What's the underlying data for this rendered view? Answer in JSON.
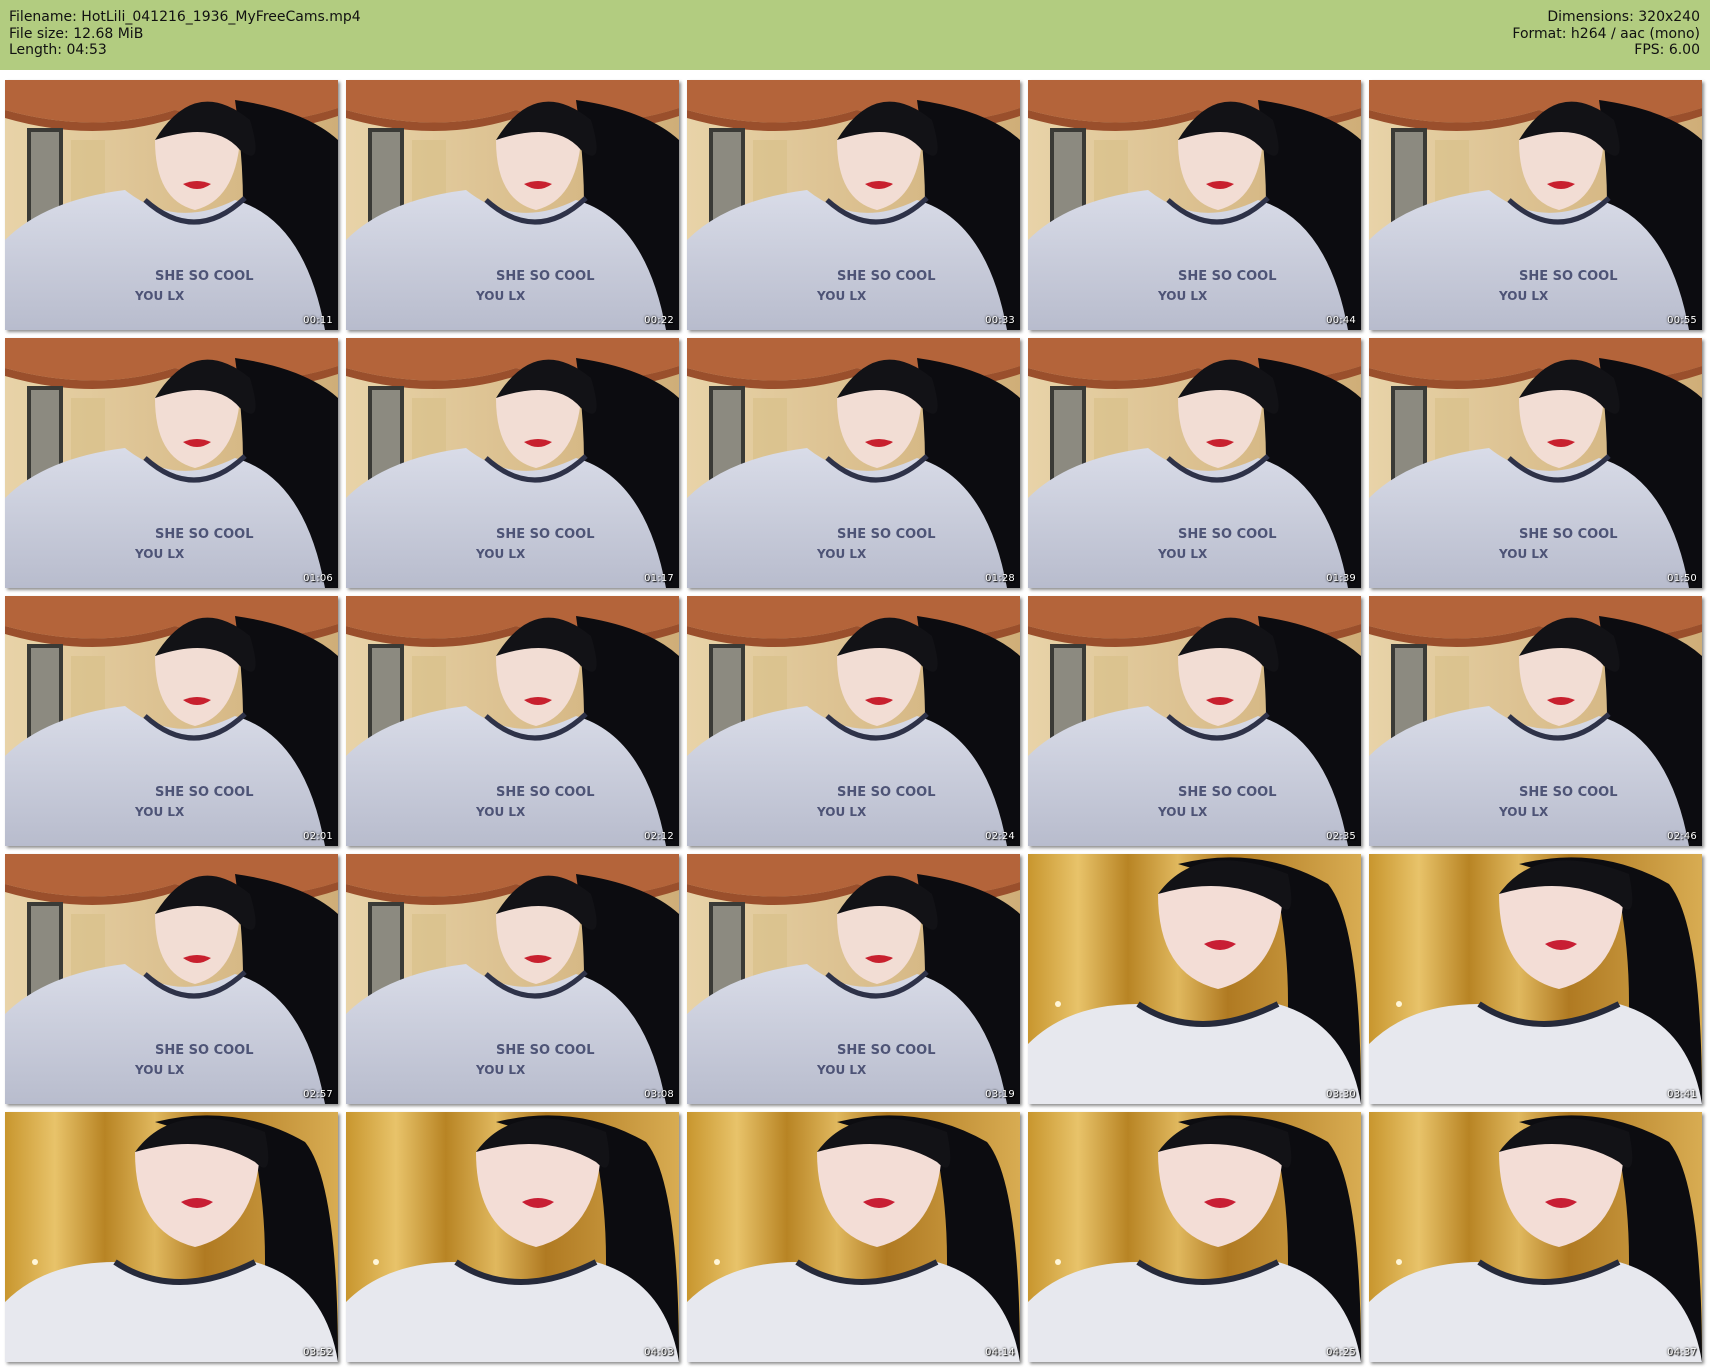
{
  "header": {
    "filename_line": "Filename: HotLili_041216_1936_MyFreeCams.mp4",
    "filesize_line": "File size: 12.68 MiB",
    "length_line": "Length: 04:53",
    "dimensions_line": "Dimensions: 320x240",
    "format_line": "Format: h264 / aac (mono)",
    "fps_line": "FPS: 6.00",
    "background_color": "#b2cc80"
  },
  "thumbnails": [
    {
      "timestamp": "00:11",
      "scene": "room"
    },
    {
      "timestamp": "00:22",
      "scene": "room"
    },
    {
      "timestamp": "00:33",
      "scene": "room"
    },
    {
      "timestamp": "00:44",
      "scene": "room"
    },
    {
      "timestamp": "00:55",
      "scene": "room"
    },
    {
      "timestamp": "01:06",
      "scene": "room"
    },
    {
      "timestamp": "01:17",
      "scene": "room"
    },
    {
      "timestamp": "01:28",
      "scene": "room"
    },
    {
      "timestamp": "01:39",
      "scene": "room"
    },
    {
      "timestamp": "01:50",
      "scene": "room"
    },
    {
      "timestamp": "02:01",
      "scene": "room"
    },
    {
      "timestamp": "02:12",
      "scene": "room"
    },
    {
      "timestamp": "02:24",
      "scene": "room"
    },
    {
      "timestamp": "02:35",
      "scene": "room"
    },
    {
      "timestamp": "02:46",
      "scene": "room"
    },
    {
      "timestamp": "02:57",
      "scene": "room"
    },
    {
      "timestamp": "03:08",
      "scene": "room"
    },
    {
      "timestamp": "03:19",
      "scene": "room"
    },
    {
      "timestamp": "03:30",
      "scene": "curtain"
    },
    {
      "timestamp": "03:41",
      "scene": "curtain"
    },
    {
      "timestamp": "03:52",
      "scene": "curtain"
    },
    {
      "timestamp": "04:03",
      "scene": "curtain"
    },
    {
      "timestamp": "04:14",
      "scene": "curtain"
    },
    {
      "timestamp": "04:25",
      "scene": "curtain"
    },
    {
      "timestamp": "04:37",
      "scene": "curtain"
    }
  ]
}
